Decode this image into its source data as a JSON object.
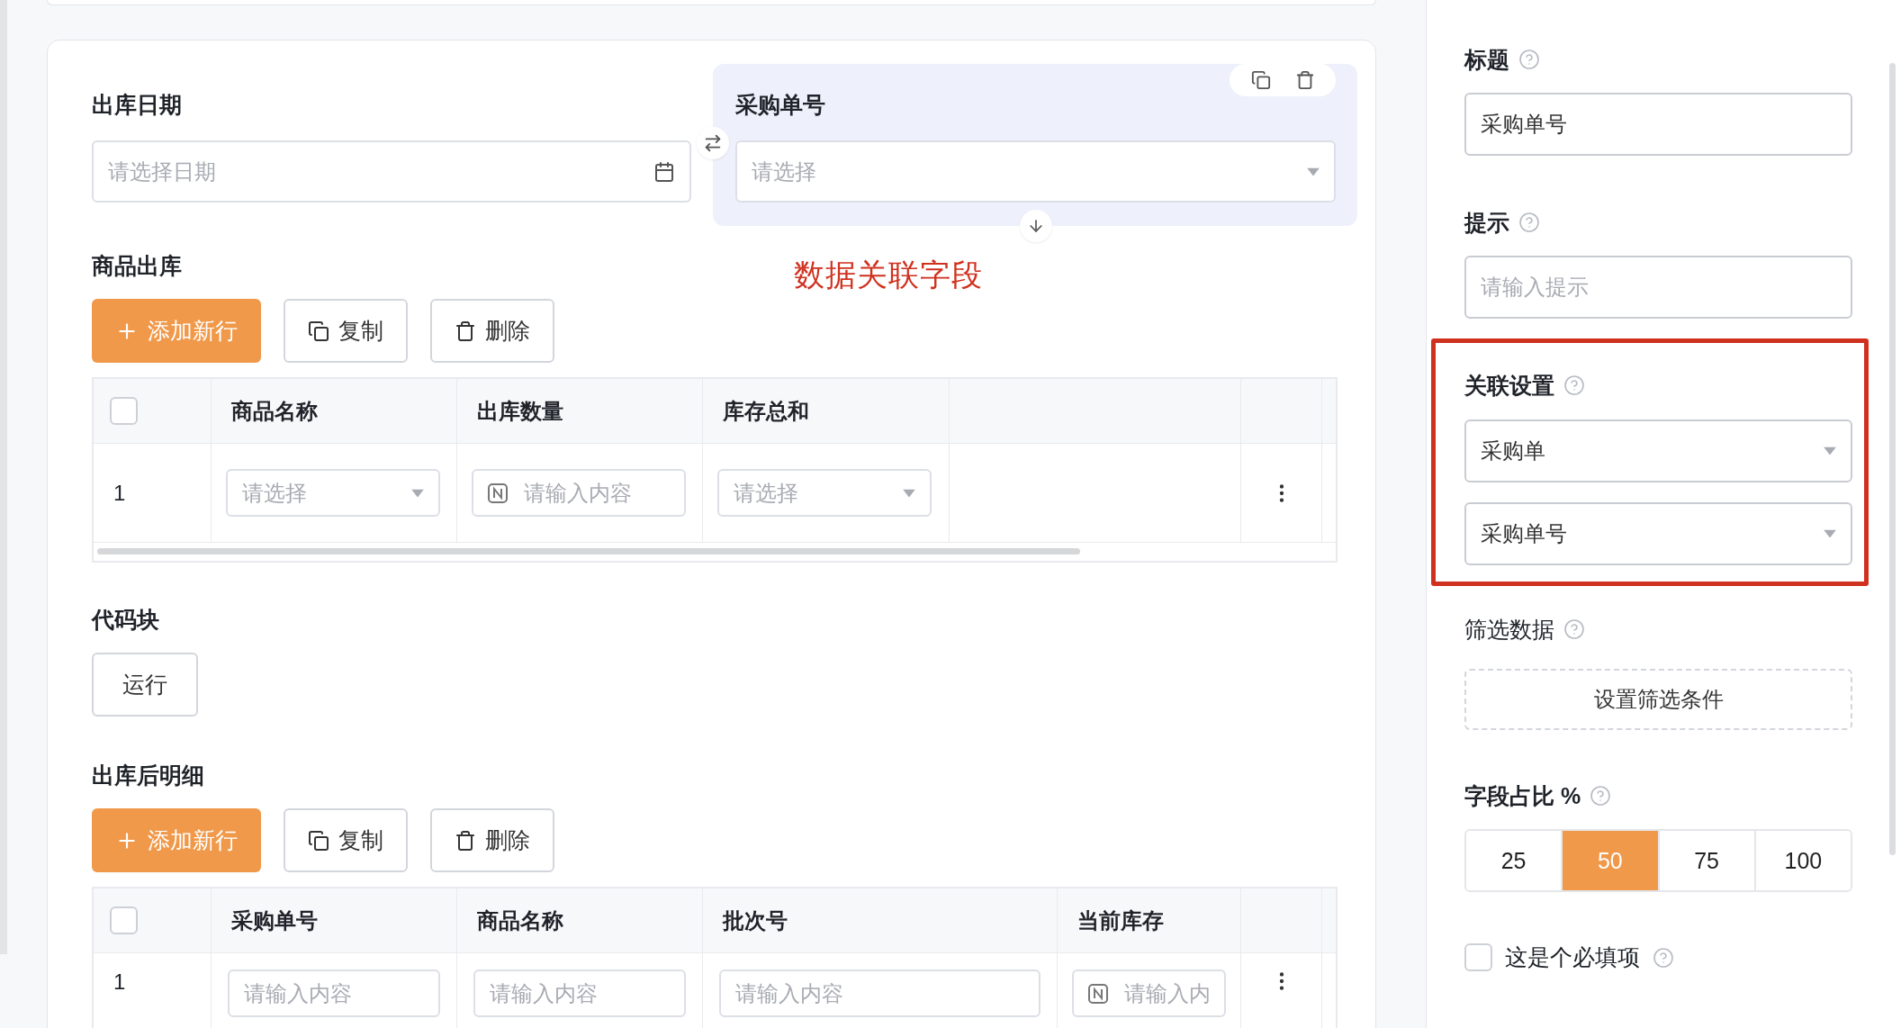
{
  "form": {
    "fields": [
      {
        "label": "出库日期",
        "placeholder": "请选择日期",
        "kind": "date",
        "selected": false
      },
      {
        "label": "采购单号",
        "placeholder": "请选择",
        "kind": "select",
        "selected": true
      }
    ],
    "annotation": "数据关联字段",
    "sections": [
      {
        "kind": "table",
        "title": "商品出库",
        "buttons": [
          {
            "kind": "add",
            "label": "添加新行"
          },
          {
            "kind": "copy",
            "label": "复制"
          },
          {
            "kind": "delete",
            "label": "删除"
          }
        ],
        "columns": [
          {
            "kind": "check",
            "checked": false
          },
          {
            "kind": "text",
            "label": "商品名称"
          },
          {
            "kind": "text",
            "label": "出库数量"
          },
          {
            "kind": "text",
            "label": "库存总和"
          },
          {
            "kind": "blank"
          },
          {
            "kind": "blank"
          }
        ],
        "rows": [
          {
            "cells": [
              {
                "kind": "index",
                "text": "1"
              },
              {
                "kind": "select",
                "placeholder": "请选择"
              },
              {
                "kind": "number",
                "placeholder": "请输入内容"
              },
              {
                "kind": "select",
                "placeholder": "请选择"
              },
              {
                "kind": "blank"
              },
              {
                "kind": "menu"
              }
            ]
          }
        ]
      },
      {
        "kind": "code",
        "title": "代码块",
        "button": "运行"
      },
      {
        "kind": "table",
        "title": "出库后明细",
        "buttons": [
          {
            "kind": "add",
            "label": "添加新行"
          },
          {
            "kind": "copy",
            "label": "复制"
          },
          {
            "kind": "delete",
            "label": "删除"
          }
        ],
        "columns": [
          {
            "kind": "check",
            "checked": false
          },
          {
            "kind": "text",
            "label": "采购单号"
          },
          {
            "kind": "text",
            "label": "商品名称"
          },
          {
            "kind": "text",
            "label": "批次号"
          },
          {
            "kind": "text",
            "label": "当前库存"
          },
          {
            "kind": "blank"
          }
        ],
        "rows": [
          {
            "cells": [
              {
                "kind": "index",
                "text": "1"
              },
              {
                "kind": "input",
                "placeholder": "请输入内容"
              },
              {
                "kind": "input",
                "placeholder": "请输入内容"
              },
              {
                "kind": "input",
                "placeholder": "请输入内容"
              },
              {
                "kind": "number",
                "placeholder": "请输入内"
              },
              {
                "kind": "menu"
              }
            ]
          }
        ]
      }
    ]
  },
  "settings": [
    {
      "kind": "text",
      "label": "标题",
      "value": "采购单号"
    },
    {
      "kind": "text",
      "label": "提示",
      "placeholder": "请输入提示"
    },
    {
      "kind": "relation",
      "label": "关联设置",
      "highlighted": true,
      "selects": [
        "采购单",
        "采购单号"
      ]
    },
    {
      "kind": "filter",
      "label": "筛选数据",
      "button": "设置筛选条件"
    },
    {
      "kind": "ratio",
      "label": "字段占比 %",
      "options": [
        {
          "label": "25",
          "selected": false
        },
        {
          "label": "50",
          "selected": true
        },
        {
          "label": "75",
          "selected": false
        },
        {
          "label": "100",
          "selected": false
        }
      ]
    },
    {
      "kind": "checkbox",
      "label": "这是个必填项",
      "checked": false
    }
  ]
}
